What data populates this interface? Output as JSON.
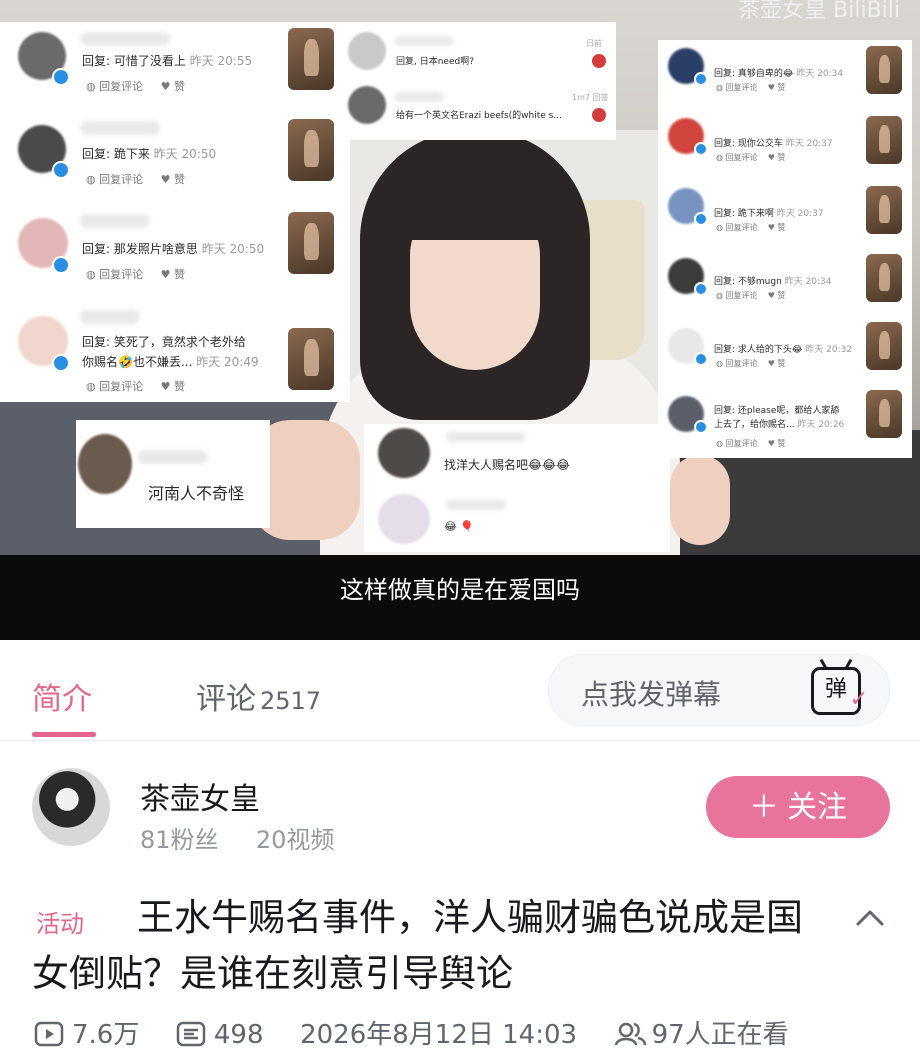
{
  "video": {
    "watermark": "茶壶女皇  BiliBili",
    "subtitle": "这样做真的是在爱国吗",
    "left_card_comments": [
      {
        "reply": "回复: 可惜了没看上",
        "time": "昨天 20:55",
        "action_reply": "回复评论",
        "action_like": "赞"
      },
      {
        "reply": "回复: 跪下来",
        "time": "昨天 20:50",
        "action_reply": "回复评论",
        "action_like": "赞"
      },
      {
        "reply": "回复: 那发照片啥意思",
        "time": "昨天 20:50",
        "action_reply": "回复评论",
        "action_like": "赞"
      },
      {
        "reply": "回复: 笑死了，竟然求个老外给",
        "reply2": "你赐名🤣也不嫌丢...",
        "time": "昨天 20:49",
        "action_reply": "回复评论",
        "action_like": "赞"
      }
    ],
    "top_middle_card": [
      {
        "text": "回复, 日本need啊?",
        "time": "日前"
      },
      {
        "text": "给有一个英文名Erazi  beefs(的white s...",
        "time": "1m7 回答"
      }
    ],
    "bottom_left_card": {
      "text": "河南人不奇怪"
    },
    "bottom_middle_card": {
      "text": "找洋大人赐名吧😂😂😂",
      "text2": "😂 🎈"
    },
    "right_card_comments": [
      {
        "reply": "回复: 真够自卑的😂",
        "time": "昨天 20:34"
      },
      {
        "reply": "回复: 现你公交车",
        "time": "昨天 20:37"
      },
      {
        "reply": "回复: 跪下来啊",
        "time": "昨天 20:37"
      },
      {
        "reply": "回复: 不够mugn",
        "time": "昨天 20:34"
      },
      {
        "reply": "回复: 求人给的下头😂",
        "time": "昨天 20:32"
      },
      {
        "reply": "回复: 还please呢，都给人家舔",
        "reply2": "上去了，给你赐名...",
        "time": "昨天 20:26"
      }
    ],
    "right_actions": {
      "reply": "回复评论",
      "like": "赞"
    }
  },
  "tabs": {
    "intro": "简介",
    "comments": "评论",
    "comment_count": "2517",
    "danmaku_placeholder": "点我发弹幕",
    "danmaku_icon_char": "弹"
  },
  "uploader": {
    "name": "茶壶女皇",
    "followers": "81粉丝",
    "videos": "20视频",
    "follow_label": "＋ 关注"
  },
  "video_info": {
    "tag": "活动",
    "title": "王水牛赐名事件，洋人骗财骗色说成是国女倒贴？是谁在刻意引导舆论",
    "plays": "7.6万",
    "danmaku_count": "498",
    "publish_time": "2026年8月12日 14:03",
    "watching": "97人正在看"
  },
  "colors": {
    "accent_pink": "#e5668d",
    "follow_bg": "#e8749c",
    "text_primary": "#18191c",
    "text_secondary": "#61666d",
    "text_muted": "#9499a0"
  },
  "icons": {
    "play": "play-count-icon",
    "danmaku": "danmaku-count-icon",
    "watching": "people-watching-icon",
    "expand": "chevron-up-icon"
  }
}
